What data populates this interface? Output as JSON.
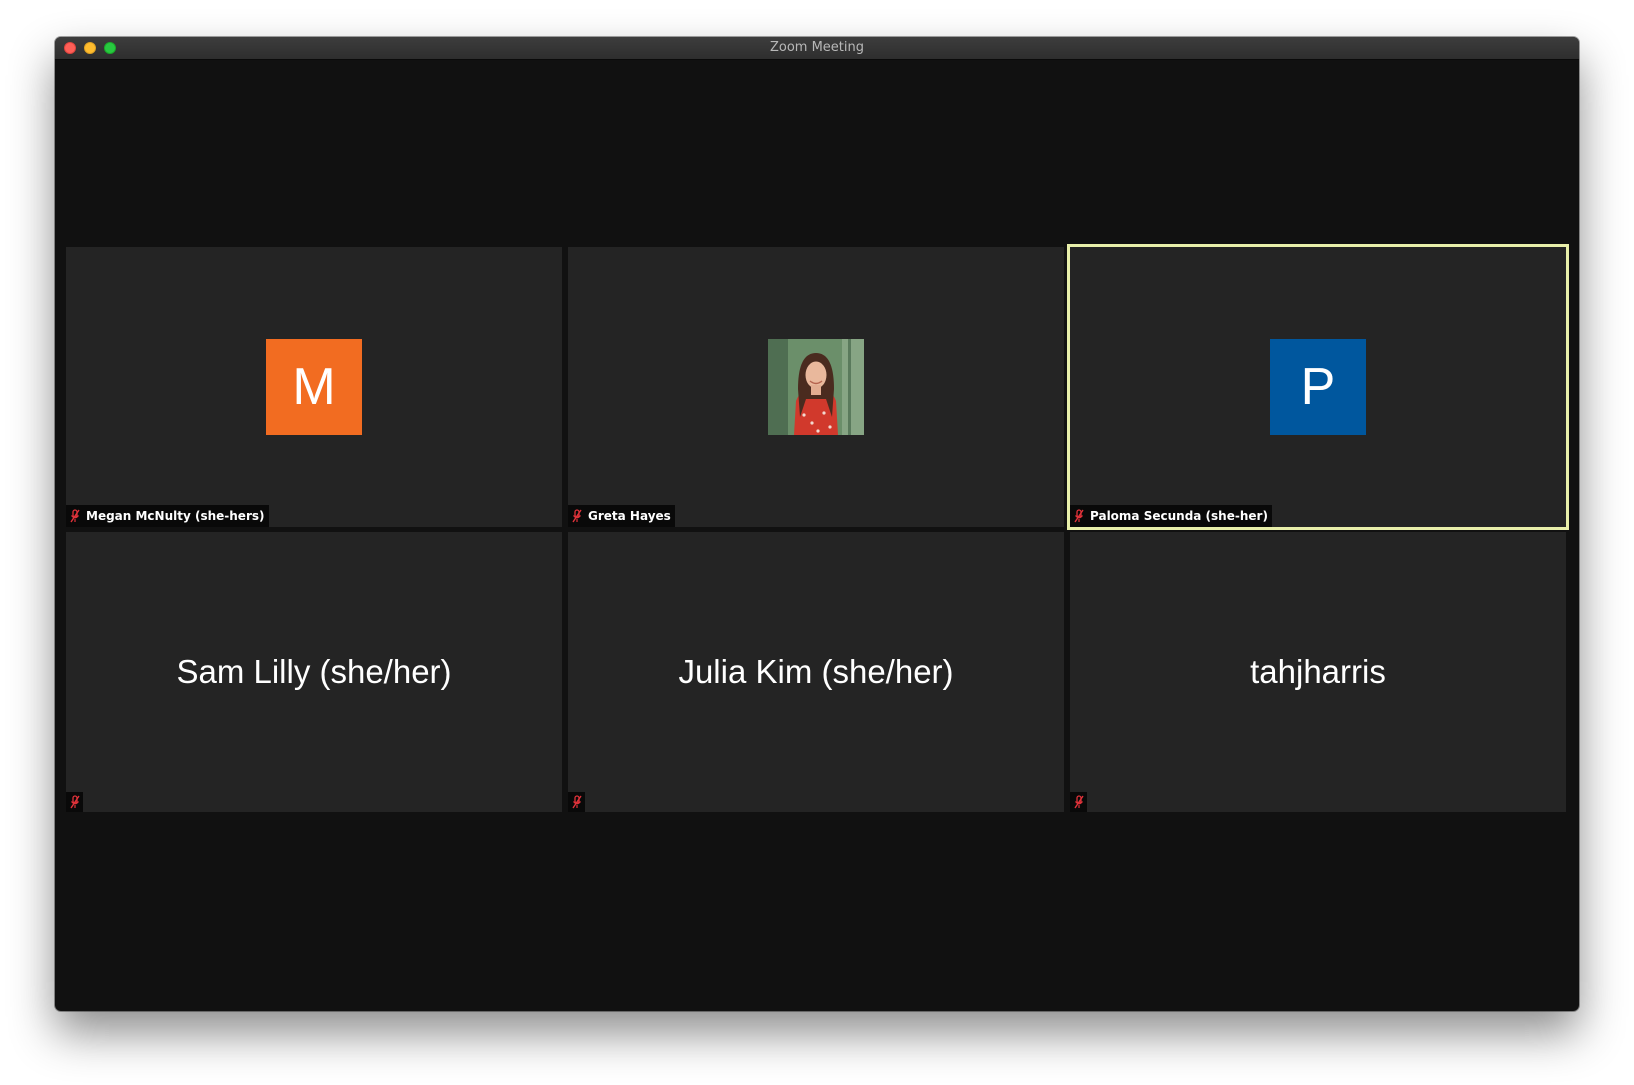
{
  "window": {
    "title": "Zoom Meeting"
  },
  "participants": [
    {
      "name": "Megan McNulty (she-hers)",
      "avatar_letter": "M",
      "avatar_color": "#f26c21",
      "muted": true,
      "active_speaker": false
    },
    {
      "name": "Greta Hayes",
      "avatar_type": "photo",
      "muted": true,
      "active_speaker": false
    },
    {
      "name": "Paloma Secunda (she-her)",
      "avatar_letter": "P",
      "avatar_color": "#00579e",
      "muted": true,
      "active_speaker": true
    },
    {
      "name": "Sam Lilly (she/her)",
      "muted": true,
      "active_speaker": false
    },
    {
      "name": "Julia Kim (she/her)",
      "muted": true,
      "active_speaker": false
    },
    {
      "name": "tahjharris",
      "muted": true,
      "active_speaker": false
    }
  ],
  "colors": {
    "active_speaker_border": "#e8efaa",
    "muted_icon": "#e0323a",
    "tile_background": "#242424",
    "window_background": "#111111"
  },
  "icons": {
    "muted": "microphone-muted-icon"
  }
}
